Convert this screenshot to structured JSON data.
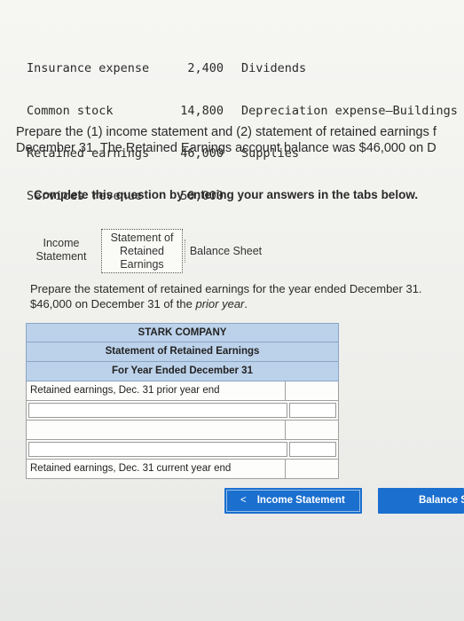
{
  "accounts": {
    "left": [
      {
        "name": "Insurance expense",
        "amount": "2,400"
      },
      {
        "name": "Common stock",
        "amount": "14,800"
      },
      {
        "name": "Retained earnings",
        "amount": "46,000"
      },
      {
        "name": "Services revenue",
        "amount": "50,000"
      }
    ],
    "right": [
      "Dividends",
      "Depreciation expense—Buildings",
      "Supplies"
    ]
  },
  "prompt": {
    "line1": "Prepare the (1) income statement and (2) statement of retained earnings f",
    "line2": "December 31. The Retained Earnings account balance was $46,000 on D"
  },
  "complete_text": "Complete this question by entering your answers in the tabs below.",
  "tabs": {
    "income_line1": "Income",
    "income_line2": "Statement",
    "retained_line1": "Statement of",
    "retained_line2": "Retained",
    "retained_line3": "Earnings",
    "balance": "Balance Sheet"
  },
  "instructions": {
    "line1": "Prepare the statement of retained earnings for the year ended December 31.",
    "line2_prefix": "$46,000 on December 31 of the ",
    "line2_italic": "prior year",
    "line2_suffix": "."
  },
  "statement": {
    "company": "STARK COMPANY",
    "title": "Statement of Retained Earnings",
    "period": "For Year Ended December 31",
    "rows": {
      "start": "Retained earnings, Dec. 31 prior year end",
      "end": "Retained earnings, Dec. 31 current year end"
    }
  },
  "nav": {
    "prev_chevron": "<",
    "prev_label": "Income Statement",
    "next_label": "Balance S"
  },
  "colors": {
    "header_fill": "#bcd2ea",
    "button_blue": "#1a6fcf"
  }
}
